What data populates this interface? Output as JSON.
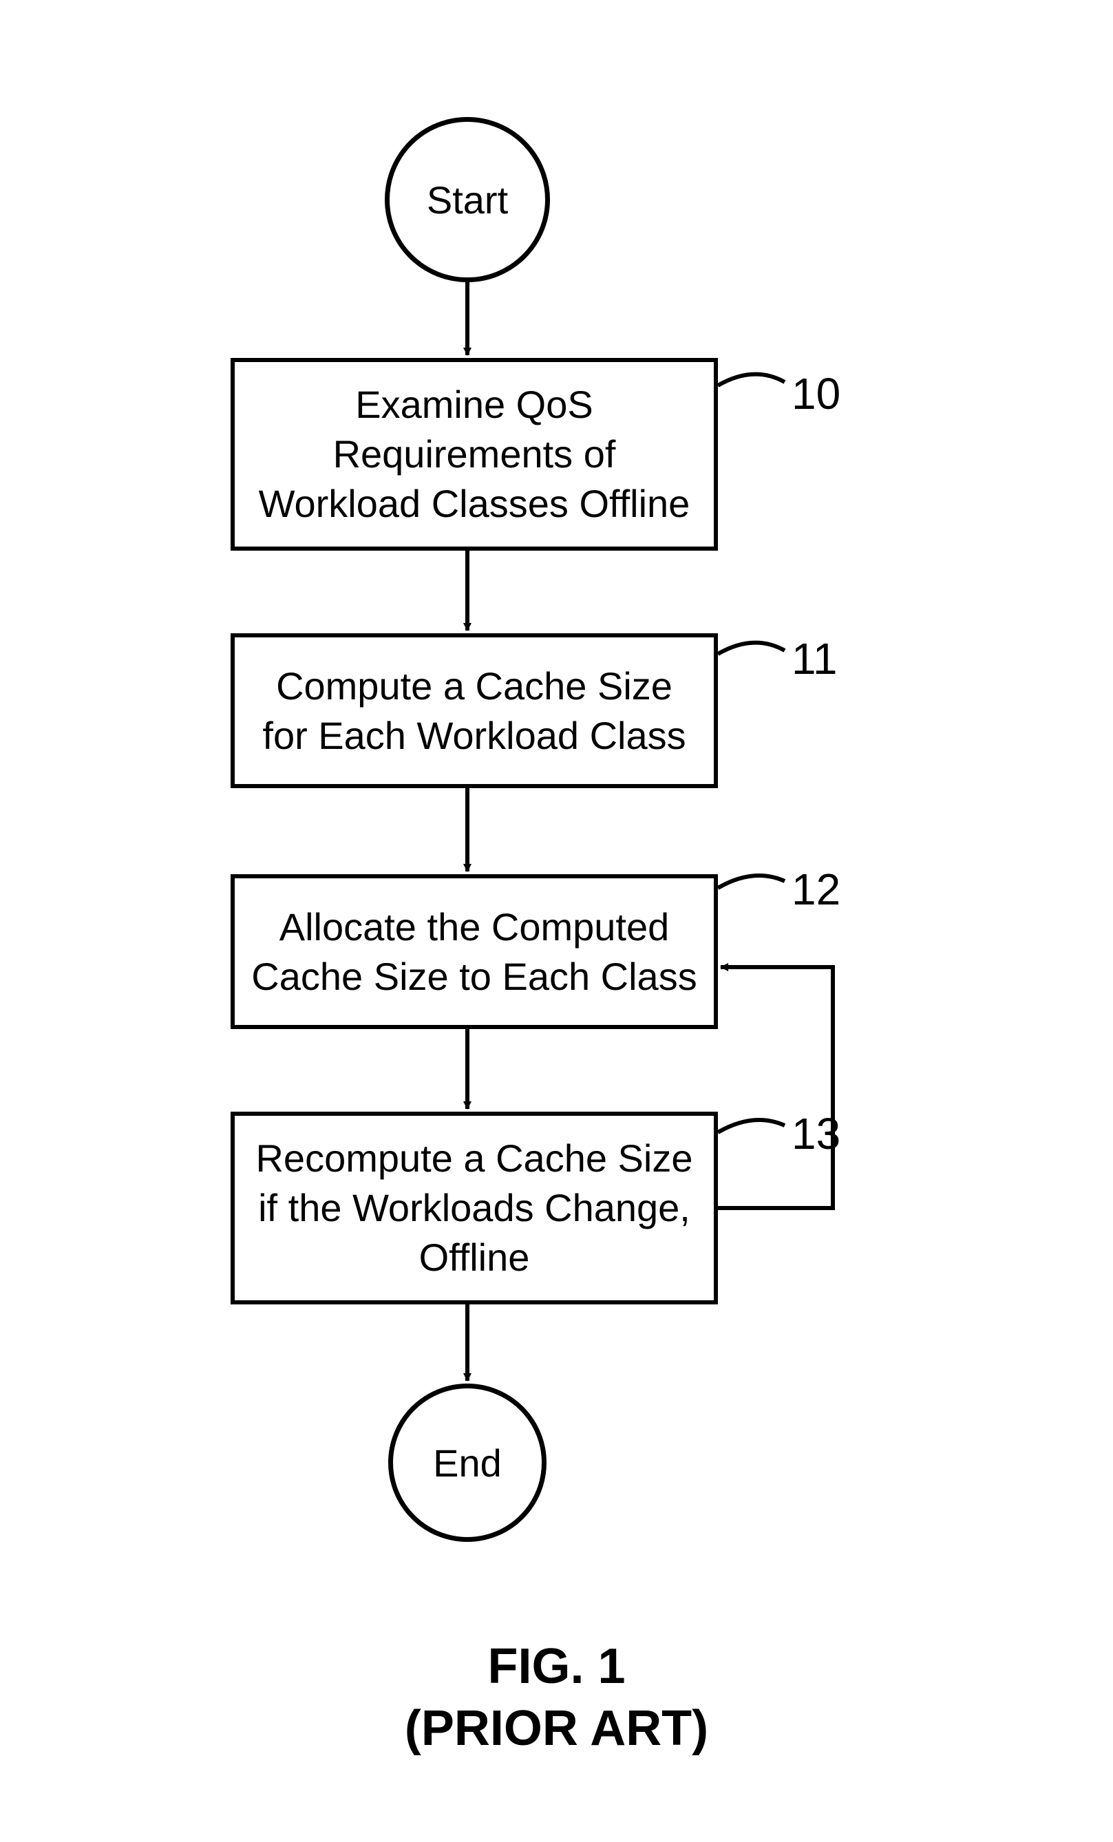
{
  "terminals": {
    "start": "Start",
    "end": "End"
  },
  "steps": {
    "s10": "Examine QoS Requirements of Workload Classes Offline",
    "s11": "Compute a Cache Size for Each Workload Class",
    "s12": "Allocate the Computed Cache Size to Each Class",
    "s13": "Recompute a Cache Size if the Workloads Change, Offline"
  },
  "labels": {
    "l10": "10",
    "l11": "11",
    "l12": "12",
    "l13": "13"
  },
  "caption": {
    "line1": "FIG. 1",
    "line2": "(PRIOR ART)"
  }
}
